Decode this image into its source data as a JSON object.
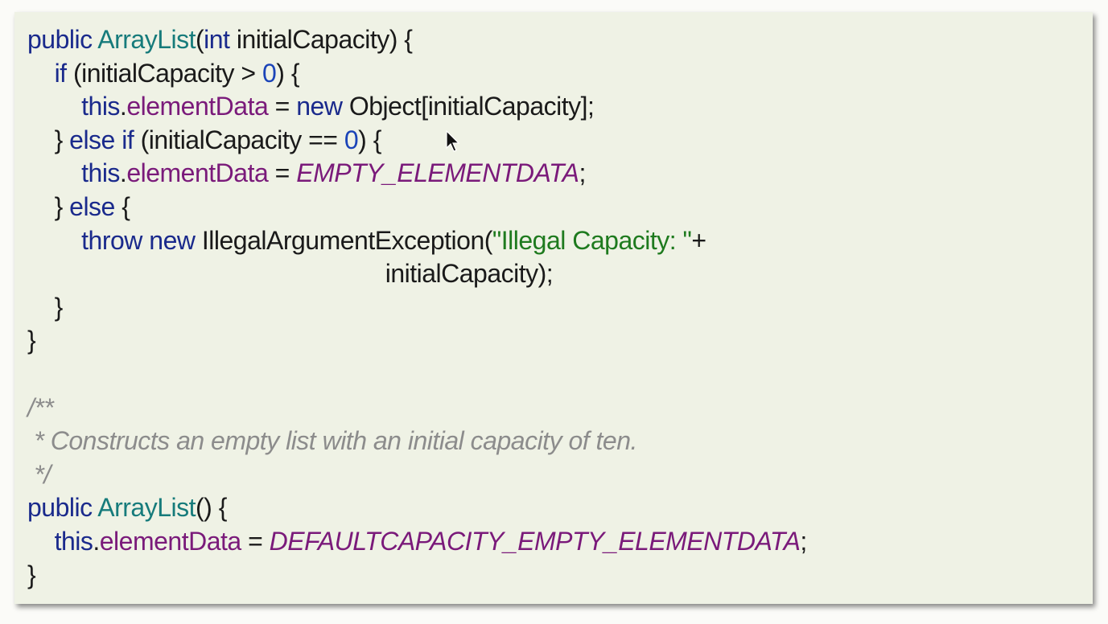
{
  "code": {
    "lines": [
      [
        {
          "t": "public ",
          "c": "kw"
        },
        {
          "t": "ArrayList",
          "c": "type"
        },
        {
          "t": "(",
          "c": "plain"
        },
        {
          "t": "int",
          "c": "kw"
        },
        {
          "t": " initialCapacity) {",
          "c": "plain"
        }
      ],
      [
        {
          "t": "    ",
          "c": "plain"
        },
        {
          "t": "if",
          "c": "kw"
        },
        {
          "t": " (initialCapacity > ",
          "c": "plain"
        },
        {
          "t": "0",
          "c": "num"
        },
        {
          "t": ") {",
          "c": "plain"
        }
      ],
      [
        {
          "t": "        ",
          "c": "plain"
        },
        {
          "t": "this",
          "c": "kw"
        },
        {
          "t": ".",
          "c": "plain"
        },
        {
          "t": "elementData",
          "c": "field"
        },
        {
          "t": " = ",
          "c": "plain"
        },
        {
          "t": "new",
          "c": "kw"
        },
        {
          "t": " Object[initialCapacity];",
          "c": "plain"
        }
      ],
      [
        {
          "t": "    } ",
          "c": "plain"
        },
        {
          "t": "else if",
          "c": "kw"
        },
        {
          "t": " (initialCapacity == ",
          "c": "plain"
        },
        {
          "t": "0",
          "c": "num"
        },
        {
          "t": ") {",
          "c": "plain"
        }
      ],
      [
        {
          "t": "        ",
          "c": "plain"
        },
        {
          "t": "this",
          "c": "kw"
        },
        {
          "t": ".",
          "c": "plain"
        },
        {
          "t": "elementData",
          "c": "field"
        },
        {
          "t": " = ",
          "c": "plain"
        },
        {
          "t": "EMPTY_ELEMENTDATA",
          "c": "const"
        },
        {
          "t": ";",
          "c": "plain"
        }
      ],
      [
        {
          "t": "    } ",
          "c": "plain"
        },
        {
          "t": "else",
          "c": "kw"
        },
        {
          "t": " {",
          "c": "plain"
        }
      ],
      [
        {
          "t": "        ",
          "c": "plain"
        },
        {
          "t": "throw new",
          "c": "kw"
        },
        {
          "t": " IllegalArgumentException(",
          "c": "plain"
        },
        {
          "t": "\"Illegal Capacity: \"",
          "c": "str"
        },
        {
          "t": "+",
          "c": "plain"
        }
      ],
      [
        {
          "t": "                                                     initialCapacity);",
          "c": "plain"
        }
      ],
      [
        {
          "t": "    }",
          "c": "plain"
        }
      ],
      [
        {
          "t": "}",
          "c": "plain"
        }
      ],
      [
        {
          "t": "",
          "c": "plain"
        }
      ],
      [
        {
          "t": "/**",
          "c": "cmt"
        }
      ],
      [
        {
          "t": " * Constructs an empty list with an initial capacity of ten.",
          "c": "cmt"
        }
      ],
      [
        {
          "t": " */",
          "c": "cmt"
        }
      ],
      [
        {
          "t": "public ",
          "c": "kw"
        },
        {
          "t": "ArrayList",
          "c": "type"
        },
        {
          "t": "() {",
          "c": "plain"
        }
      ],
      [
        {
          "t": "    ",
          "c": "plain"
        },
        {
          "t": "this",
          "c": "kw"
        },
        {
          "t": ".",
          "c": "plain"
        },
        {
          "t": "elementData",
          "c": "field"
        },
        {
          "t": " = ",
          "c": "plain"
        },
        {
          "t": "DEFAULTCAPACITY_EMPTY_ELEMENTDATA",
          "c": "const"
        },
        {
          "t": ";",
          "c": "plain"
        }
      ],
      [
        {
          "t": "}",
          "c": "plain"
        }
      ]
    ]
  },
  "cursor": {
    "icon": "mouse-pointer-icon"
  },
  "colors": {
    "panel_background": "#eff2e5",
    "keyword": "#1a2a8c",
    "type": "#167b7b",
    "field": "#7a1a7a",
    "constant": "#7a1a7a",
    "number": "#1b44b8",
    "string": "#1e7a1e",
    "comment": "#8c8c8c"
  }
}
